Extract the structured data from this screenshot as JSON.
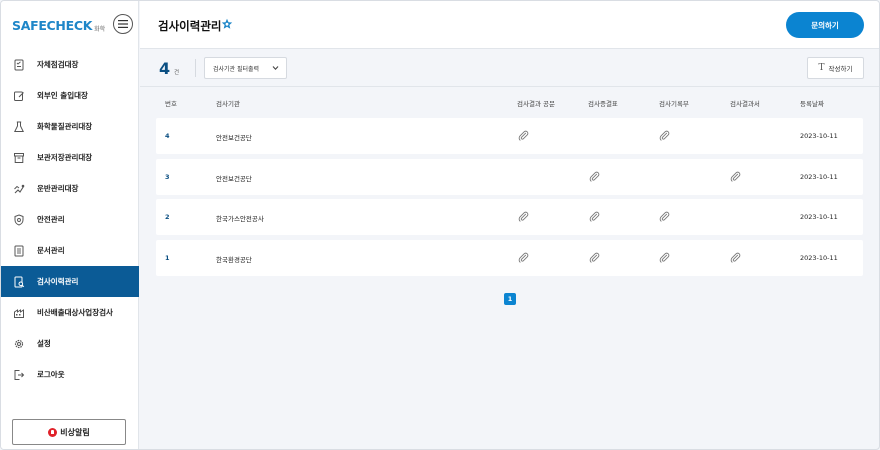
{
  "brand": {
    "logo": "SAFECHECK",
    "sub": "화학"
  },
  "sidebar": {
    "items": [
      {
        "label": "자체점검대장",
        "icon": "checklist-icon"
      },
      {
        "label": "외부인 출입대장",
        "icon": "edit-icon"
      },
      {
        "label": "화학물질관리대장",
        "icon": "flask-icon"
      },
      {
        "label": "보관저장관리대장",
        "icon": "archive-icon"
      },
      {
        "label": "운반관리대장",
        "icon": "truck-icon"
      },
      {
        "label": "안전관리",
        "icon": "shield-icon"
      },
      {
        "label": "문서관리",
        "icon": "document-icon"
      },
      {
        "label": "검사이력관리",
        "icon": "inspection-icon",
        "active": true
      },
      {
        "label": "비산배출대상사업장검사",
        "icon": "factory-icon"
      },
      {
        "label": "설정",
        "icon": "gear-icon"
      },
      {
        "label": "로그아웃",
        "icon": "logout-icon"
      }
    ],
    "alarm_label": "비상알림"
  },
  "header": {
    "title": "검사이력관리",
    "inquiry_label": "문의하기"
  },
  "toolbar": {
    "count": "4",
    "count_unit": "건",
    "filter_label": "검사기관 필터출력",
    "write_label": "작성하기"
  },
  "table": {
    "columns": [
      "번호",
      "검사기관",
      "검사결과 공문",
      "검사증결표",
      "검사기록부",
      "검사결과서",
      "등록날짜"
    ],
    "rows": [
      {
        "no": "4",
        "agency": "안전보건공단",
        "attachments": [
          true,
          false,
          true,
          false
        ],
        "date": "2023-10-11"
      },
      {
        "no": "3",
        "agency": "안전보건공단",
        "attachments": [
          false,
          true,
          false,
          true
        ],
        "date": "2023-10-11"
      },
      {
        "no": "2",
        "agency": "한국가스안전공사",
        "attachments": [
          true,
          true,
          true,
          false
        ],
        "date": "2023-10-11"
      },
      {
        "no": "1",
        "agency": "한국환경공단",
        "attachments": [
          true,
          true,
          true,
          true
        ],
        "date": "2023-10-11"
      }
    ]
  },
  "pagination": {
    "current": "1"
  },
  "colors": {
    "accent": "#0b84d1",
    "active_nav": "#0b5b96",
    "brand": "#1e86c8",
    "alarm": "#e0222a"
  }
}
